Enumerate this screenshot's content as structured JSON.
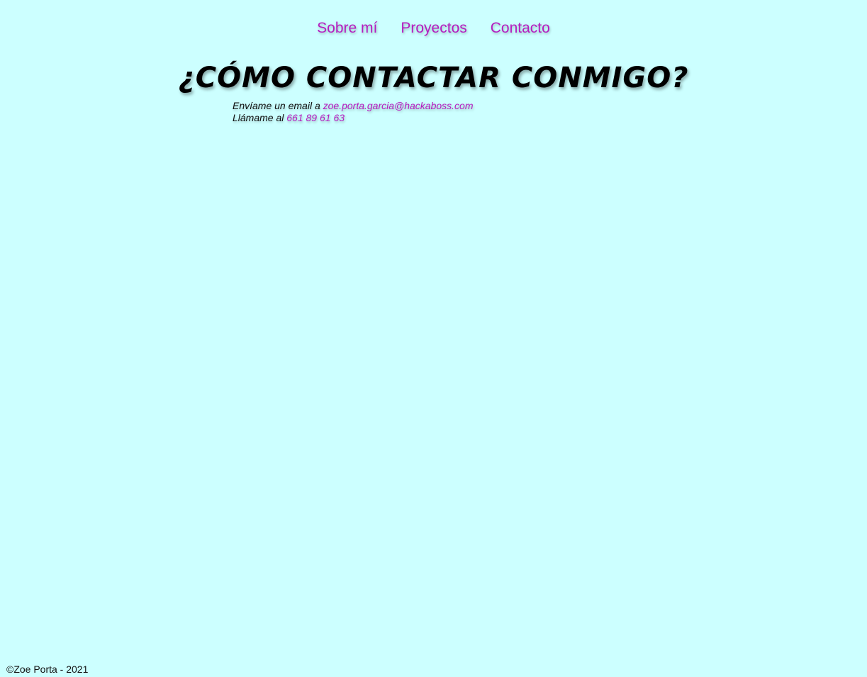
{
  "nav": {
    "items": [
      {
        "label": "Sobre mí"
      },
      {
        "label": "Proyectos"
      },
      {
        "label": "Contacto"
      }
    ]
  },
  "main": {
    "title": "¿Cómo contactar conmigo?",
    "email_prefix": "Envíame un email a",
    "email": "zoe.porta.garcia@hackaboss.com",
    "phone_prefix": "Llámame al",
    "phone": "661 89 61 63"
  },
  "footer": {
    "copyright": "©Zoe Porta - 2021"
  },
  "colors": {
    "background": "#ccffff",
    "accent": "#b51cc0",
    "text": "#111111"
  }
}
